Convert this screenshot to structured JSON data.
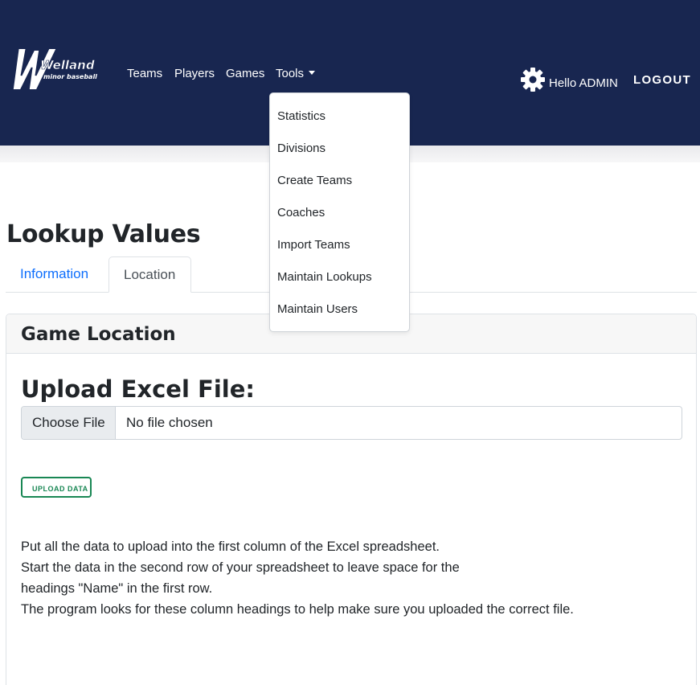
{
  "brand": {
    "logo_main": "Welland",
    "logo_sub": "minor baseball"
  },
  "nav": {
    "links": [
      "Teams",
      "Players",
      "Games",
      "Tools"
    ],
    "greeting": "Hello ADMIN",
    "logout": "LOGOUT",
    "tools_menu": [
      "Statistics",
      "Divisions",
      "Create Teams",
      "Coaches",
      "Import Teams",
      "Maintain Lookups",
      "Maintain Users"
    ]
  },
  "page": {
    "title": "Lookup Values",
    "tabs": [
      {
        "label": "Information",
        "active": false
      },
      {
        "label": "Location",
        "active": true
      }
    ]
  },
  "card": {
    "header": "Game Location",
    "upload_title": "Upload Excel File:",
    "file_button": "Choose File",
    "file_status": "No file chosen",
    "upload_button": "UPLOAD DATA",
    "instructions": [
      "Put all the data to upload into the first column of the Excel spreadsheet.",
      "Start the data in the second row of your spreadsheet to leave space for the",
      "headings \"Name\" in the first row.",
      "The program looks for these column headings to help make sure you uploaded the correct file."
    ]
  },
  "colors": {
    "navbar": "#182650",
    "link": "#0d6efd",
    "success": "#198754"
  },
  "icons": {
    "settings": "gear-icon",
    "dropdown": "caret-down-icon"
  }
}
